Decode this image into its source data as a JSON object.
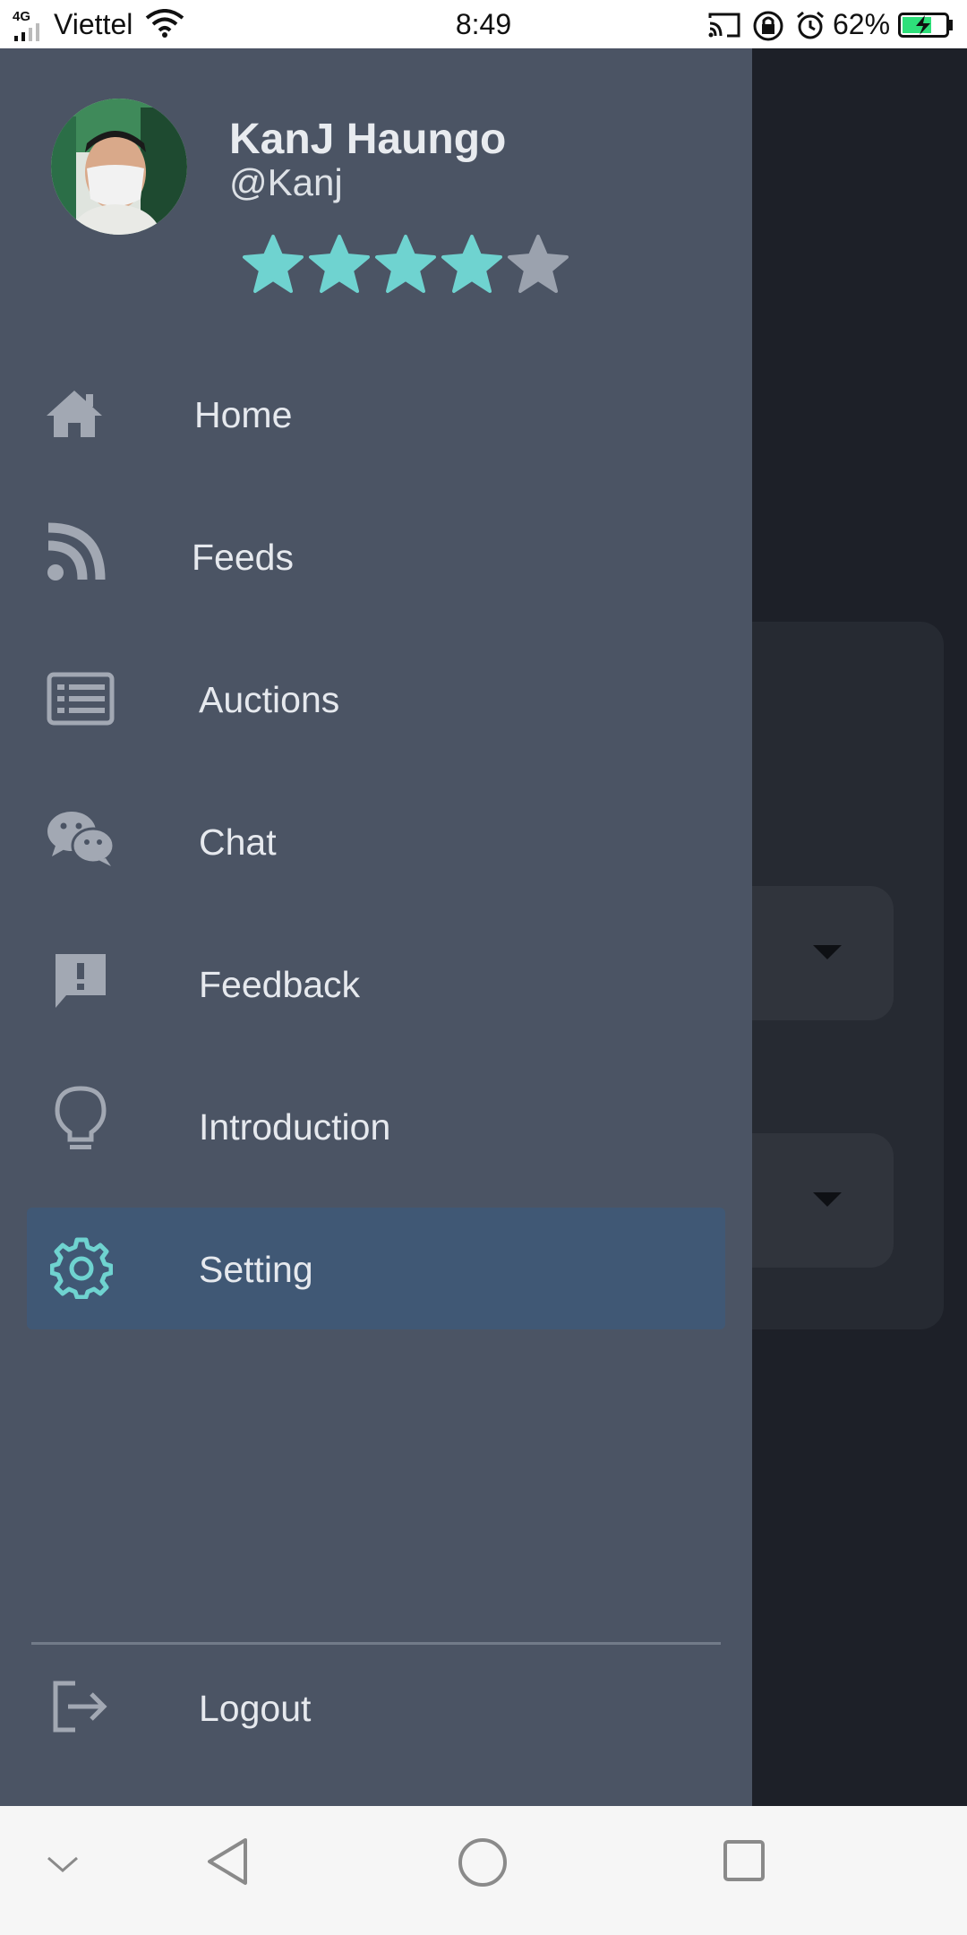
{
  "status_bar": {
    "network": "4G",
    "carrier": "Viettel",
    "time": "8:49",
    "battery_percent": "62%",
    "battery_level": 0.62,
    "charging": true
  },
  "drawer": {
    "user": {
      "name": "KanJ Haungo",
      "handle": "@Kanj",
      "rating": 4,
      "rating_max": 5
    },
    "items": [
      {
        "label": "Home",
        "icon": "home-icon"
      },
      {
        "label": "Feeds",
        "icon": "rss-icon"
      },
      {
        "label": "Auctions",
        "icon": "list-icon"
      },
      {
        "label": "Chat",
        "icon": "wechat-icon"
      },
      {
        "label": "Feedback",
        "icon": "feedback-icon"
      },
      {
        "label": "Introduction",
        "icon": "lightbulb-icon"
      },
      {
        "label": "Setting",
        "icon": "gear-icon",
        "active": true
      }
    ],
    "logout": {
      "label": "Logout",
      "icon": "logout-icon"
    }
  },
  "colors": {
    "drawer_bg": "#4b5464",
    "accent": "#6fd3d0",
    "active_item_bg": "#405875",
    "icon_inactive": "#a2a8b3",
    "star_filled": "#6fd3d0",
    "star_empty": "#9ba2ae"
  },
  "nav_bar": {
    "buttons": [
      "collapse-icon",
      "back-icon",
      "home-circle-icon",
      "recents-icon"
    ]
  }
}
